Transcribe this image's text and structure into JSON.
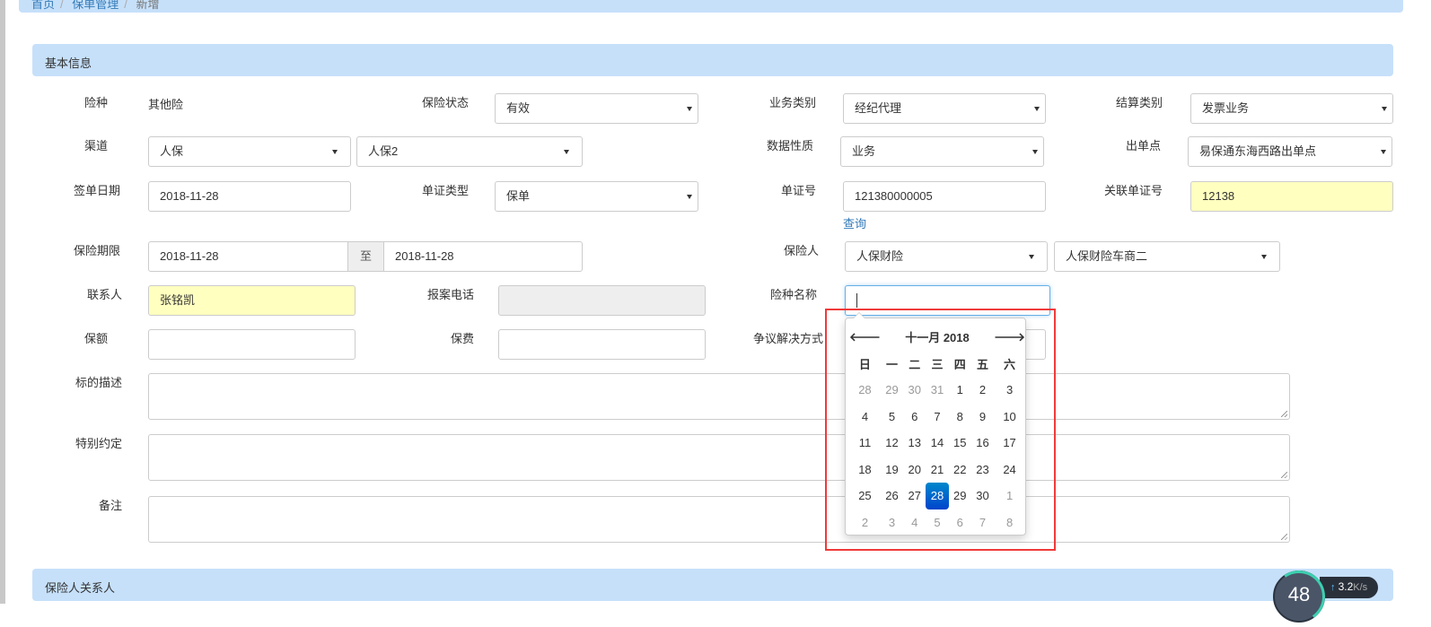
{
  "breadcrumb": [
    "首页",
    "保单管理",
    "新增"
  ],
  "section1": "基本信息",
  "section2": "保险人关系人",
  "fields": {
    "xianzhong": {
      "label": "险种",
      "value": "其他险"
    },
    "status": {
      "label": "保险状态",
      "value": "有效"
    },
    "biz_type": {
      "label": "业务类别",
      "value": "经纪代理"
    },
    "settle_type": {
      "label": "结算类别",
      "value": "发票业务"
    },
    "channel": {
      "label": "渠道",
      "value1": "人保",
      "value2": "人保2"
    },
    "data_nature": {
      "label": "数据性质",
      "value": "业务"
    },
    "issue_point": {
      "label": "出单点",
      "value": "易保通东海西路出单点"
    },
    "sign_date": {
      "label": "签单日期",
      "value": "2018-11-28"
    },
    "doc_type": {
      "label": "单证类型",
      "value": "保单"
    },
    "doc_no": {
      "label": "单证号",
      "value": "121380000005",
      "link": "查询"
    },
    "rel_doc_no": {
      "label": "关联单证号",
      "value": "12138"
    },
    "period": {
      "label": "保险期限",
      "from": "2018-11-28",
      "sep": "至",
      "to": "2018-11-28"
    },
    "insurer": {
      "label": "保险人",
      "value1": "人保财险",
      "value2": "人保财险车商二"
    },
    "contact": {
      "label": "联系人",
      "value": "张铭凯"
    },
    "report_phone": {
      "label": "报案电话",
      "value": ""
    },
    "product_name": {
      "label": "险种名称",
      "value": ""
    },
    "amount": {
      "label": "保额",
      "value": ""
    },
    "premium": {
      "label": "保费",
      "value": ""
    },
    "dispute": {
      "label": "争议解决方式",
      "value": ""
    },
    "subject": {
      "label": "标的描述"
    },
    "special": {
      "label": "特别约定"
    },
    "remark": {
      "label": "备注"
    }
  },
  "calendar": {
    "title": "十一月 2018",
    "prev": "🡐",
    "next": "🡒",
    "weekdays": [
      "日",
      "一",
      "二",
      "三",
      "四",
      "五",
      "六"
    ],
    "weeks": [
      [
        "28",
        "29",
        "30",
        "31",
        "1",
        "2",
        "3"
      ],
      [
        "4",
        "5",
        "6",
        "7",
        "8",
        "9",
        "10"
      ],
      [
        "11",
        "12",
        "13",
        "14",
        "15",
        "16",
        "17"
      ],
      [
        "18",
        "19",
        "20",
        "21",
        "22",
        "23",
        "24"
      ],
      [
        "25",
        "26",
        "27",
        "28",
        "29",
        "30",
        "1"
      ],
      [
        "2",
        "3",
        "4",
        "5",
        "6",
        "7",
        "8"
      ]
    ],
    "selected": "28"
  },
  "widget": {
    "value": "48",
    "speed": "3.2",
    "unit": "K/s",
    "arrow": "↑"
  }
}
